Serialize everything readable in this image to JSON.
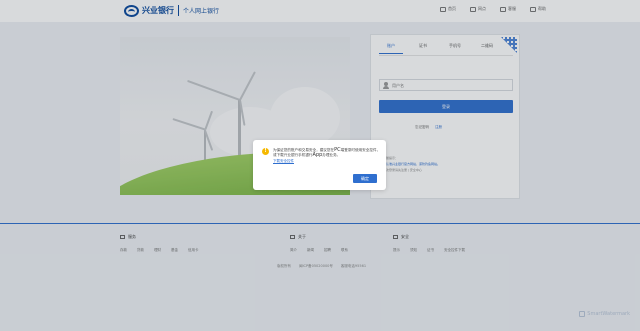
{
  "header": {
    "logo_text": "兴业银行",
    "logo_subtitle": "个人网上银行",
    "nav": [
      {
        "label": "首页",
        "icon": "home-icon"
      },
      {
        "label": "网点",
        "icon": "location-icon"
      },
      {
        "label": "客服",
        "icon": "chat-icon"
      },
      {
        "label": "帮助",
        "icon": "headset-icon"
      }
    ]
  },
  "login": {
    "tabs": [
      "账户",
      "证书",
      "手机号",
      "二维码"
    ],
    "active_tab": 0,
    "username_placeholder": "用户名",
    "login_button": "登录",
    "forgot_link": "忘记密码",
    "register_link": "注册",
    "notice_lines": [
      "温馨提示：",
      "请认准兴业银行官方网站，谨防钓鱼网站。",
      "首次登录请先注册 | 安全中心"
    ]
  },
  "modal": {
    "message_part1": "为保证您的账户和交易安全，建议您在",
    "message_pc": "PC",
    "message_part2": "端登录时使用安全控件，或下载兴业银行手机银行",
    "message_app": "App",
    "message_part3": "办理业务。",
    "link": "下载安全控件",
    "confirm_button": "确定"
  },
  "footer": {
    "columns": [
      {
        "title": "服务",
        "links": [
          "存款",
          "贷款",
          "理财",
          "基金",
          "信用卡"
        ]
      },
      {
        "title": "关于",
        "links": [
          "简介",
          "新闻",
          "招聘",
          "联系"
        ]
      },
      {
        "title": "安全",
        "links": [
          "提示",
          "须知",
          "证书",
          "安全控件下载"
        ]
      }
    ],
    "bottom": [
      "版权所有",
      "闽ICP备05020000号",
      "客服电话95561"
    ]
  },
  "watermark": "SmartWatermark"
}
